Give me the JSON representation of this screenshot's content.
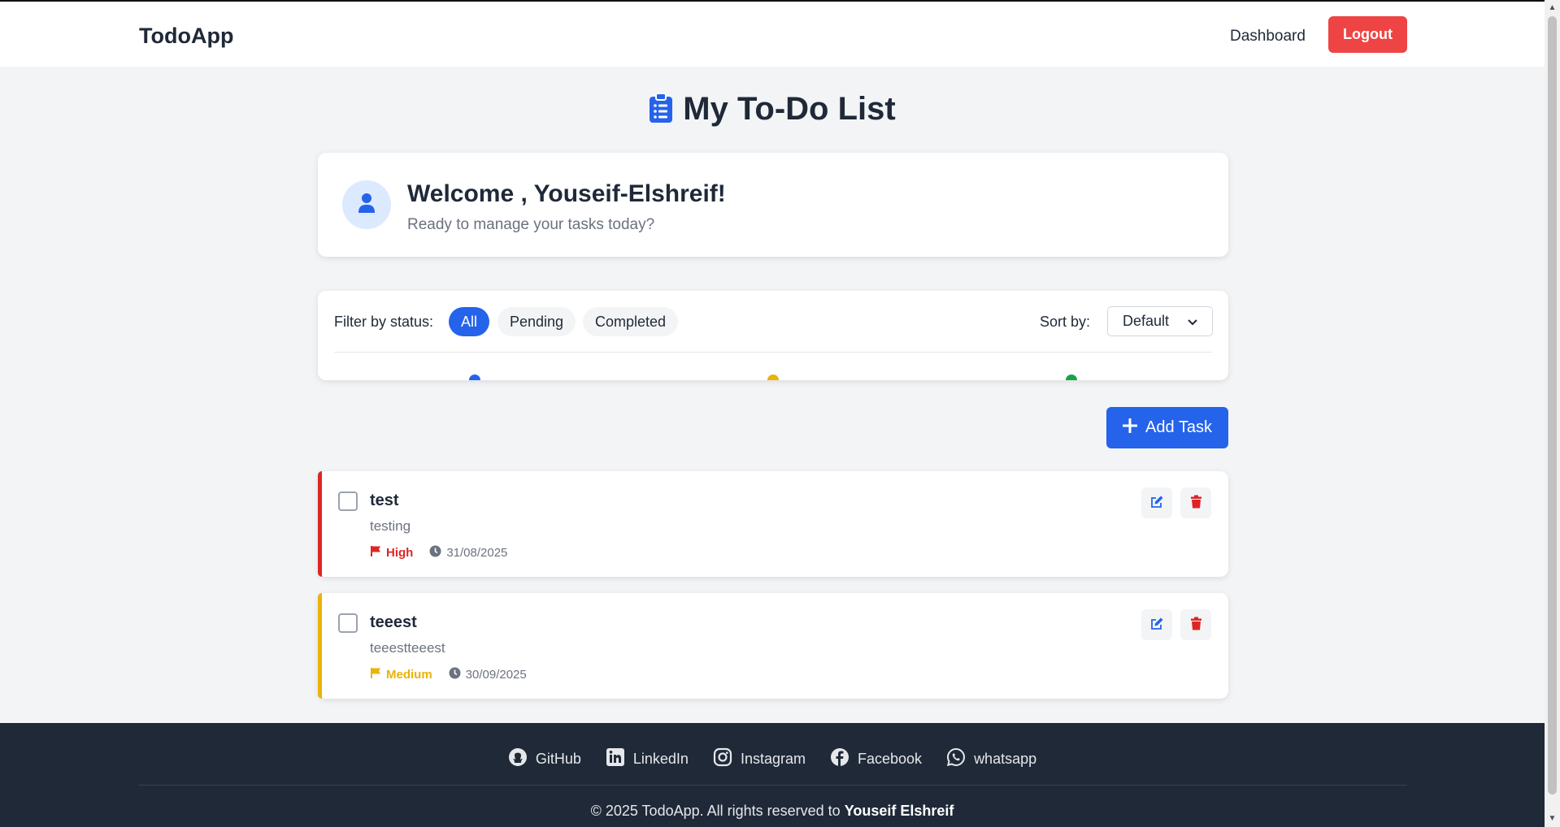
{
  "navbar": {
    "brand": "TodoApp",
    "dashboard_label": "Dashboard",
    "logout_label": "Logout"
  },
  "page": {
    "title": "My To-Do List"
  },
  "welcome": {
    "title": "Welcome , Youseif-Elshreif!",
    "subtitle": "Ready to manage your tasks today?"
  },
  "filters": {
    "label": "Filter by status:",
    "options": [
      "All",
      "Pending",
      "Completed"
    ],
    "active": "All",
    "sort_label": "Sort by:",
    "sort_value": "Default"
  },
  "add_task_label": "Add Task",
  "tasks": [
    {
      "title": "test",
      "description": "testing",
      "priority": "High",
      "priority_color": "#dc2626",
      "due_date": "31/08/2025",
      "completed": false
    },
    {
      "title": "teeest",
      "description": "teeestteeest",
      "priority": "Medium",
      "priority_color": "#eab308",
      "due_date": "30/09/2025",
      "completed": false
    }
  ],
  "footer": {
    "links": [
      "GitHub",
      "LinkedIn",
      "Instagram",
      "Facebook",
      "whatsapp"
    ],
    "copyright_prefix": "© 2025 TodoApp. All rights reserved to",
    "copyright_name": "Youseif Elshreif"
  },
  "colors": {
    "primary": "#2563eb",
    "danger": "#ef4444",
    "footer_bg": "#1f2937",
    "page_bg": "#f3f4f6"
  },
  "icons": {
    "title": "clipboard-list-icon",
    "avatar": "user-icon",
    "add": "plus-icon",
    "priority": "flag-icon",
    "due": "clock-icon",
    "edit": "edit-icon",
    "delete": "trash-icon"
  }
}
